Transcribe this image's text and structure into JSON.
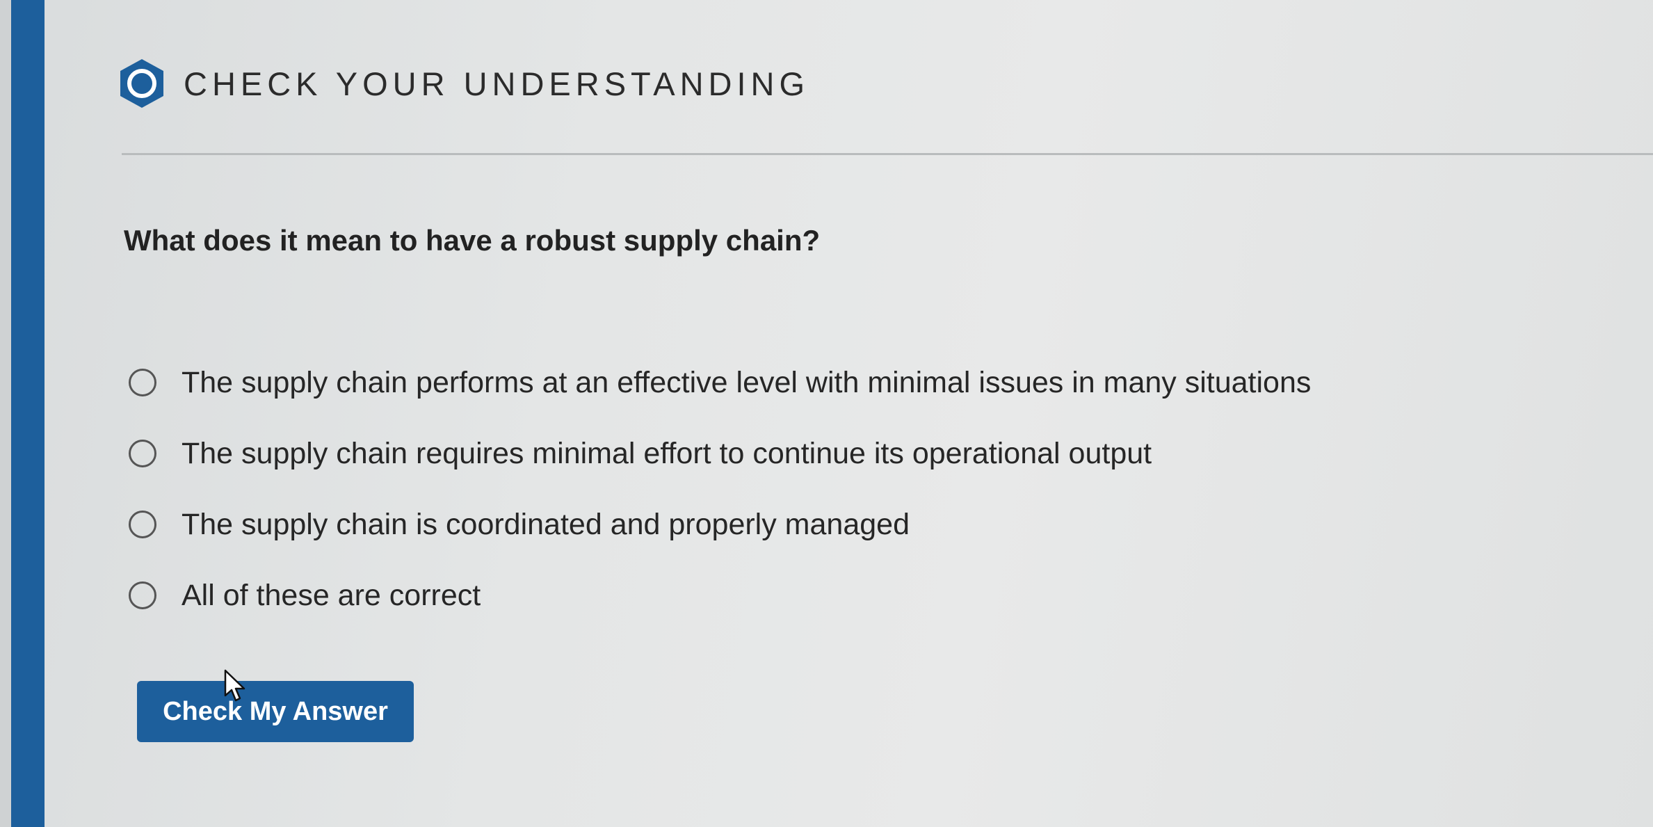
{
  "header": {
    "title": "CHECK YOUR UNDERSTANDING",
    "icon": "hexagon-ring-icon"
  },
  "question": {
    "text": "What does it mean to have a robust supply chain?"
  },
  "options": [
    {
      "label": "The supply chain performs at an effective level with minimal issues in many situations",
      "selected": false
    },
    {
      "label": "The supply chain requires minimal effort to continue its operational output",
      "selected": false
    },
    {
      "label": "The supply chain is coordinated and properly managed",
      "selected": false
    },
    {
      "label": "All of these are correct",
      "selected": false
    }
  ],
  "actions": {
    "check_label": "Check My Answer"
  },
  "colors": {
    "accent": "#1d5f9c",
    "background": "#e4e6e6"
  }
}
